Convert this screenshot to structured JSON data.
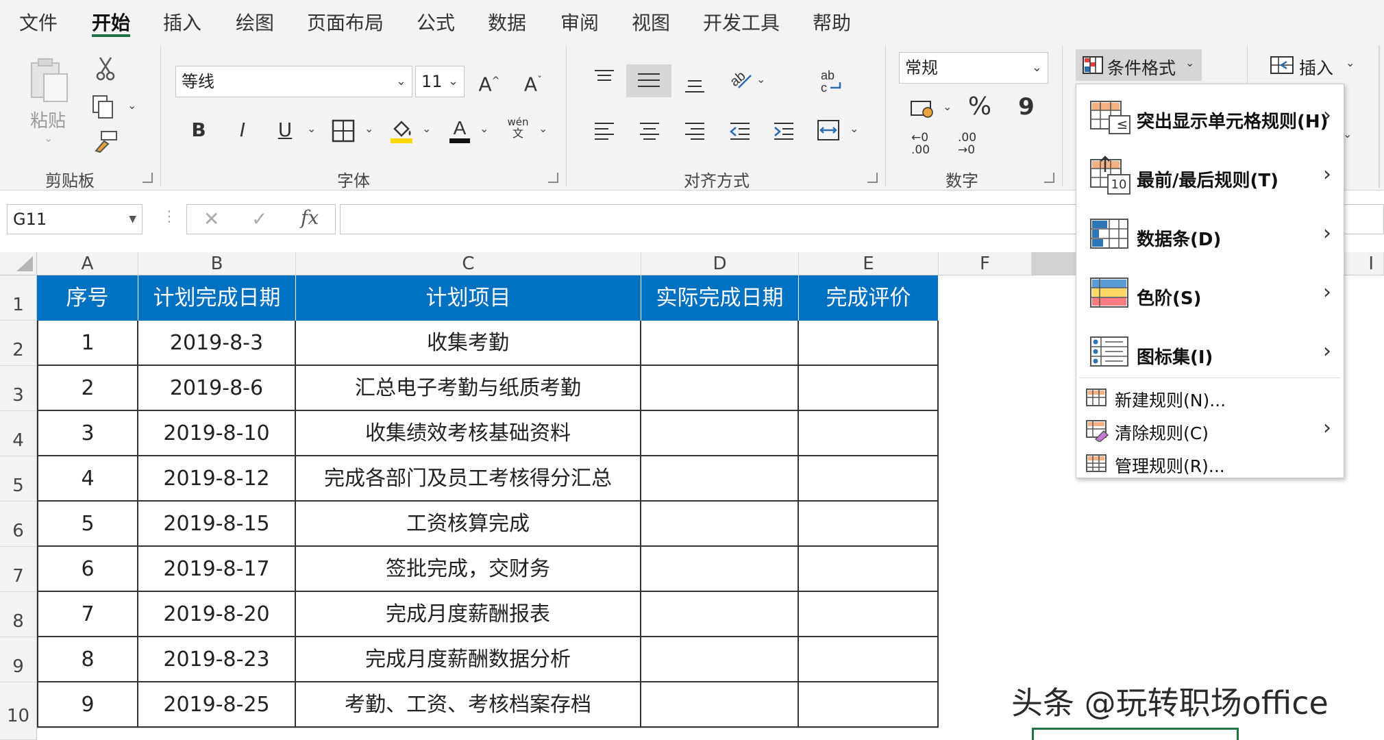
{
  "tabs": [
    "文件",
    "开始",
    "插入",
    "绘图",
    "页面布局",
    "公式",
    "数据",
    "审阅",
    "视图",
    "开发工具",
    "帮助"
  ],
  "active_tab": "开始",
  "clipboard": {
    "paste_label": "粘贴",
    "group_label": "剪贴板"
  },
  "font": {
    "name": "等线",
    "size": "11",
    "group_label": "字体",
    "bold": "B",
    "italic": "I",
    "underline": "U",
    "grow": "A",
    "shrink": "A",
    "phonetic_top": "wén",
    "phonetic_bottom": "文"
  },
  "alignment": {
    "group_label": "对齐方式"
  },
  "number": {
    "format": "常规",
    "percent": "%",
    "comma": "9",
    "group_label": "数字",
    "inc_decimal_top": "←0",
    "inc_decimal_bottom": ".00",
    "dec_decimal_top": ".00",
    "dec_decimal_bottom": "→0"
  },
  "styles": {
    "conditional_format": "条件格式"
  },
  "cells": {
    "insert": "插入"
  },
  "formula_bar": {
    "name_box": "G11",
    "cancel": "✕",
    "enter": "✓",
    "fx": "fx",
    "value": ""
  },
  "columns": [
    "A",
    "B",
    "C",
    "D",
    "E",
    "F",
    "I"
  ],
  "rows": [
    "1",
    "2",
    "3",
    "4",
    "5",
    "6",
    "7",
    "8",
    "9",
    "10"
  ],
  "table": {
    "headers": [
      "序号",
      "计划完成日期",
      "计划项目",
      "实际完成日期",
      "完成评价"
    ],
    "rows": [
      [
        "1",
        "2019-8-3",
        "收集考勤",
        "",
        ""
      ],
      [
        "2",
        "2019-8-6",
        "汇总电子考勤与纸质考勤",
        "",
        ""
      ],
      [
        "3",
        "2019-8-10",
        "收集绩效考核基础资料",
        "",
        ""
      ],
      [
        "4",
        "2019-8-12",
        "完成各部门及员工考核得分汇总",
        "",
        ""
      ],
      [
        "5",
        "2019-8-15",
        "工资核算完成",
        "",
        ""
      ],
      [
        "6",
        "2019-8-17",
        "签批完成，交财务",
        "",
        ""
      ],
      [
        "7",
        "2019-8-20",
        "完成月度薪酬报表",
        "",
        ""
      ],
      [
        "8",
        "2019-8-23",
        "完成月度薪酬数据分析",
        "",
        ""
      ],
      [
        "9",
        "2019-8-25",
        "考勤、工资、考核档案存档",
        "",
        ""
      ]
    ]
  },
  "cf_menu": {
    "items": [
      {
        "label": "突出显示单元格规则(H)",
        "icon": "highlight-rules-icon"
      },
      {
        "label": "最前/最后规则(T)",
        "icon": "top-bottom-rules-icon",
        "badge": "10"
      },
      {
        "label": "数据条(D)",
        "icon": "data-bars-icon"
      },
      {
        "label": "色阶(S)",
        "icon": "color-scales-icon"
      },
      {
        "label": "图标集(I)",
        "icon": "icon-sets-icon"
      }
    ],
    "small_items": [
      {
        "label": "新建规则(N)..."
      },
      {
        "label": "清除规则(C)"
      },
      {
        "label": "管理规则(R)..."
      }
    ],
    "highlight_symbol": "≤"
  },
  "watermark": "头条 @玩转职场office",
  "colors": {
    "accent": "#217346",
    "header_fill": "#0070c0",
    "ribbon_bg": "#f3f3f3"
  }
}
